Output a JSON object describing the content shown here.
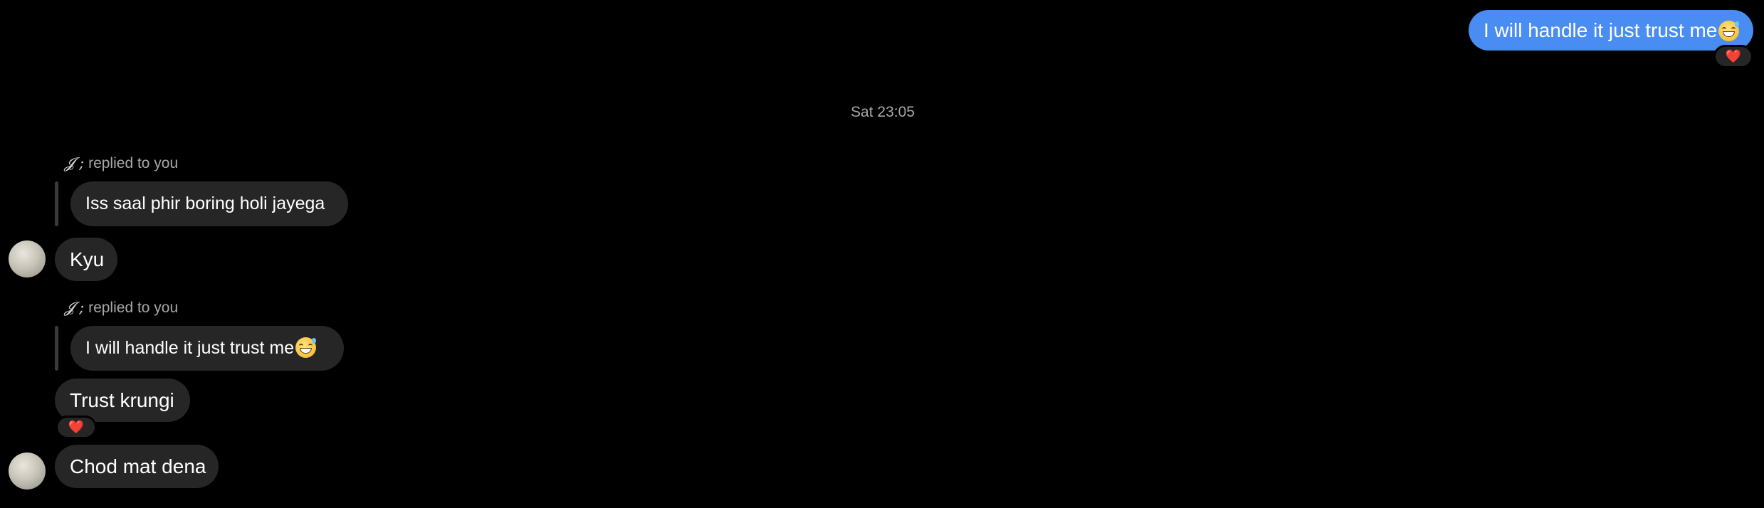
{
  "outgoing": {
    "text": "I will handle it just trust me",
    "emoji": "grinning-sweat-emoji",
    "reaction": "❤️",
    "bubble_color": "#4a8df2"
  },
  "timestamp": "Sat 23:05",
  "thread": [
    {
      "reply_name": "𝓙 ;",
      "reply_suffix": " replied to you",
      "quoted_text": "Iss saal phir boring holi jayega",
      "message": "Kyu"
    },
    {
      "reply_name": "𝓙 ;",
      "reply_suffix": " replied to you",
      "quoted_text": "I will handle it just trust me",
      "quoted_emoji": "grinning-sweat-emoji",
      "message": "Trust krungi",
      "reaction": "❤️"
    },
    {
      "message": "Chod mat dena"
    }
  ],
  "colors": {
    "background": "#000000",
    "incoming_bubble": "#262626",
    "secondary_text": "#a8a8a8",
    "reaction_heart": "#ff3040"
  }
}
